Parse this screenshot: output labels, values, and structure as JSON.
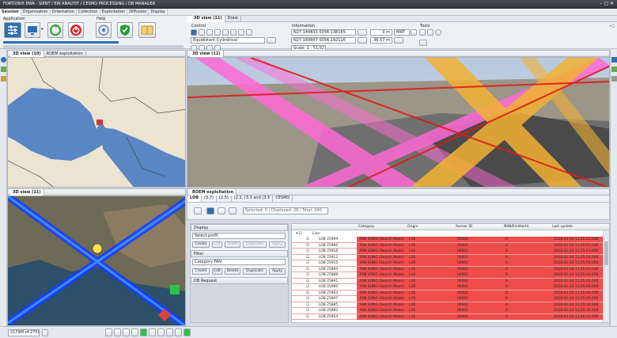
{
  "title_bar": {
    "text": "FORTION® EWA - SIENT / EW ANALYST / CESMO PROCESSING / DB MANAGER"
  },
  "menu": [
    "Session",
    "Organisation",
    "Orientation",
    "Collection",
    "Exploitation",
    "Diffusion",
    "Display"
  ],
  "ribbon": {
    "application_label": "Application",
    "help_label": "Help",
    "view_tabs": [
      "3D view (11)",
      "Draw"
    ],
    "control_label": "Control",
    "projection": "Equidistant Cylindrical",
    "information_label": "Information",
    "coord_lat": "N27.144833 0056.138165",
    "coord_lon": "N27.169667 0056.192116",
    "altitude": "0 m",
    "altitude_ref": "MNT",
    "distance": "36.57 m",
    "scale": "Scale: 1 : 51,027",
    "tools_label": "Tools"
  },
  "left_top": {
    "tabs": [
      "3D view (10)",
      "ROEM exploitation"
    ]
  },
  "left_bottom": {
    "tabs": [
      "3D view (11)"
    ]
  },
  "right_top": {
    "tabs": [
      "3D view (12)"
    ]
  },
  "roem": {
    "tabs": [
      "ROEM exploitation",
      "CESMO"
    ],
    "subtabs": [
      "LOB",
      "(3.7)",
      "(2.5)",
      "(2.2, (3.3 and (3.5",
      "CESMO"
    ],
    "status": "Selected: 0 / Displayed: 28 / Total: 240",
    "display_label": "Display",
    "profil_value": "Select profil",
    "filter_label": "Filter",
    "filter_value": "Category FAN",
    "db_request_label": "DB Request",
    "buttons": [
      "Create",
      "Edit",
      "Delete",
      "Duplicate",
      "Apply"
    ],
    "columns": [
      "Category",
      "Origin",
      "Sensor ID",
      "NSN/EmitterId",
      "Last update"
    ],
    "group_label": "Live",
    "rows": [
      {
        "name": "LOB 25909",
        "category": "FAN SONG (Search Mode)",
        "origin": "L16",
        "sensor": "00002",
        "nsn": "0",
        "updated": "2018-01-24 11:25:51.000"
      },
      {
        "name": "LOB 25906",
        "category": "FAN SONG (Search Mode)",
        "origin": "L16",
        "sensor": "00001",
        "nsn": "0",
        "updated": "2018-01-24 11:25:51.000"
      },
      {
        "name": "LOB 25918",
        "category": "FAN SONG (Search Mode)",
        "origin": "L16",
        "sensor": "00002",
        "nsn": "0",
        "updated": "2018-01-24 11:25:53.000"
      },
      {
        "name": "LOB 25912",
        "category": "FAN SONG (Search Mode)",
        "origin": "L16",
        "sensor": "00001",
        "nsn": "0",
        "updated": "2018-01-24 11:25:56.000"
      },
      {
        "name": "LOB 25915",
        "category": "FAN SONG (Search Mode)",
        "origin": "L16",
        "sensor": "00002",
        "nsn": "0",
        "updated": "2018-01-24 11:25:56.000"
      },
      {
        "name": "LOB 25894",
        "category": "FAN SONG (Search Mode)",
        "origin": "L16",
        "sensor": "00002",
        "nsn": "0",
        "updated": "2018-01-24 11:25:41.000"
      },
      {
        "name": "LOB 25888",
        "category": "FAN SONG (Search Mode)",
        "origin": "L16",
        "sensor": "00001",
        "nsn": "0",
        "updated": "2018-01-24 11:25:42.000"
      },
      {
        "name": "LOB 25891",
        "category": "FAN SONG (Search Mode)",
        "origin": "L16",
        "sensor": "00002",
        "nsn": "0",
        "updated": "2018-01-24 11:25:42.000"
      },
      {
        "name": "LOB 25900",
        "category": "FAN SONG (Search Mode)",
        "origin": "L16",
        "sensor": "00001",
        "nsn": "0",
        "updated": "2018-01-24 11:25:46.000"
      },
      {
        "name": "LOB 25903",
        "category": "FAN SONG (Search Mode)",
        "origin": "L16",
        "sensor": "00002",
        "nsn": "0",
        "updated": "2018-01-24 11:25:46.000"
      },
      {
        "name": "LOB 25897",
        "category": "FAN SONG (Search Mode)",
        "origin": "L16",
        "sensor": "00001",
        "nsn": "0",
        "updated": "2018-01-24 11:25:45.000"
      },
      {
        "name": "LOB 25885",
        "category": "FAN SONG (Search Mode)",
        "origin": "L16",
        "sensor": "00002",
        "nsn": "0",
        "updated": "2018-01-24 11:25:36.000"
      },
      {
        "name": "LOB 25882",
        "category": "FAN SONG (Search Mode)",
        "origin": "L16",
        "sensor": "00001",
        "nsn": "0",
        "updated": "2018-01-24 11:25:35.000"
      },
      {
        "name": "LOB 25954",
        "category": "FAN SONG (Search Mode)",
        "origin": "L16",
        "sensor": "00002",
        "nsn": "0",
        "updated": "2018-01-24 11:26:15.000"
      }
    ]
  },
  "status_bar": {
    "memory": "2179M of 2758M"
  },
  "colors": {
    "row_red": "#ef4c4c",
    "accent_blue": "#2f6db5",
    "lob_pink": "#ff6ad5",
    "lob_orange": "#f2b233"
  }
}
